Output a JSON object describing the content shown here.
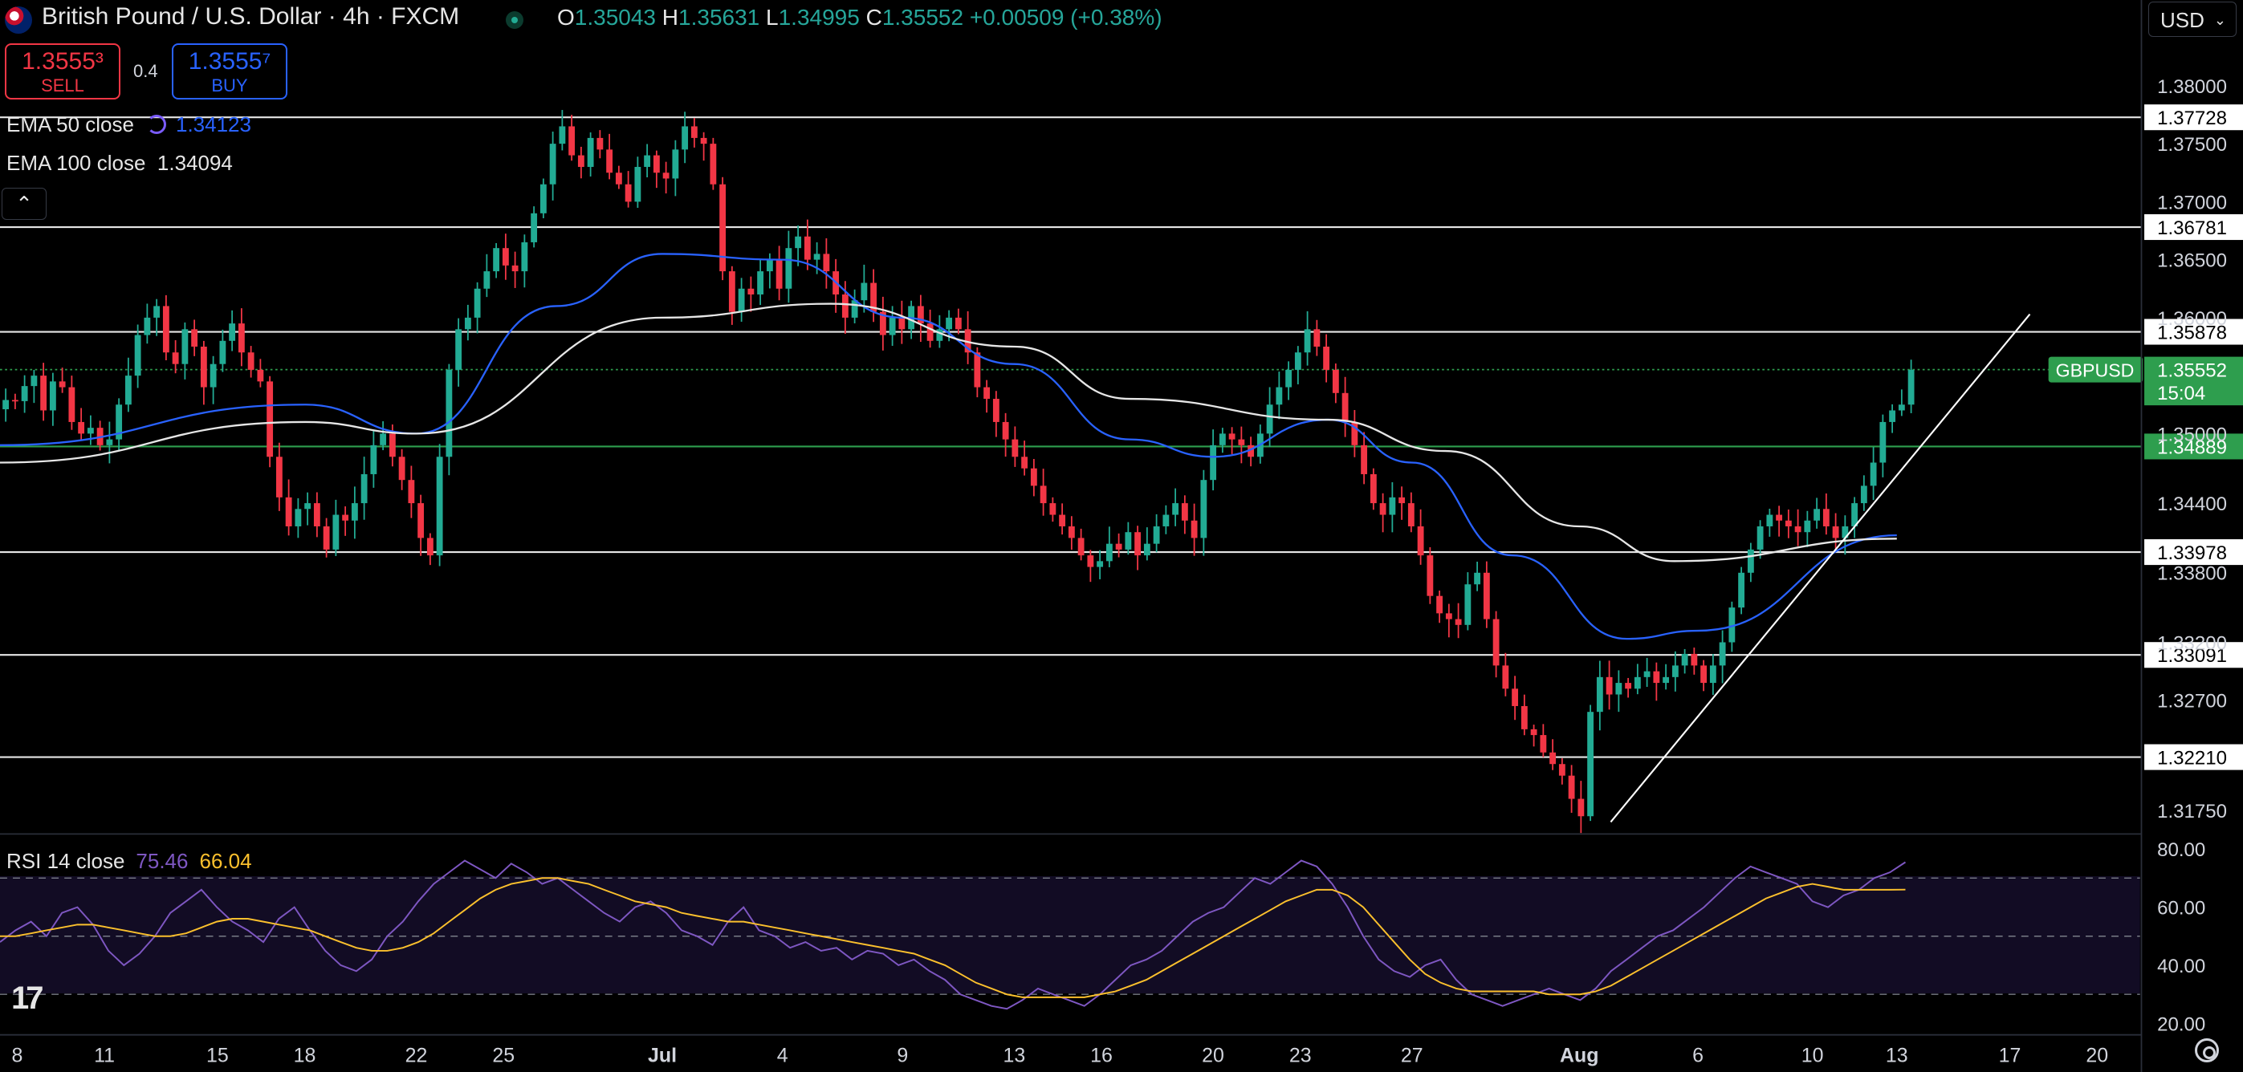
{
  "header": {
    "title": "British Pound / U.S. Dollar · 4h · FXCM",
    "ohlc": [
      {
        "k": "O",
        "v": "1.35043"
      },
      {
        "k": "H",
        "v": "1.35631"
      },
      {
        "k": "L",
        "v": "1.34995"
      },
      {
        "k": "C",
        "v": "1.35552"
      }
    ],
    "change": "+0.00509 (+0.38%)"
  },
  "trade": {
    "sell_price": "1.3555³",
    "sell_label": "SELL",
    "spread": "0.4",
    "buy_price": "1.3555⁷",
    "buy_label": "BUY"
  },
  "indicators": {
    "ema50_label": "EMA 50 close",
    "ema50_value": "1.34123",
    "ema100_label": "EMA 100 close",
    "ema100_value": "1.34094",
    "rsi_label": "RSI 14 close",
    "rsi_value": "75.46",
    "rsi_ma_value": "66.04"
  },
  "currency": "USD",
  "symbol_tag": {
    "symbol": "GBPUSD",
    "price": "1.35552",
    "countdown": "15:04"
  },
  "colors": {
    "up": "#26a69a",
    "up_candle": "#22ab94",
    "down": "#f23645",
    "ema50": "#2962ff",
    "ema100": "#e6e6e6",
    "rsi": "#7e57c2",
    "rsi_ma": "#fbc02d",
    "accent_green": "#2e9e4e"
  },
  "icons": [
    "flag-gb-icon",
    "market-status-icon",
    "sync-icon",
    "chevron-up-icon",
    "tradingview-logo",
    "settings-icon"
  ],
  "chart_data": {
    "type": "candlestick",
    "symbol": "GBPUSD",
    "timeframe": "4h",
    "price_axis_labels": [
      "1.38000",
      "1.37500",
      "1.37000",
      "1.36500",
      "1.36000",
      "1.35000",
      "1.34400",
      "1.33800",
      "1.33200",
      "1.32700",
      "1.31750"
    ],
    "ylim": [
      1.3165,
      1.3825
    ],
    "horizontal_levels": [
      {
        "value": 1.37728,
        "label": "1.37728"
      },
      {
        "value": 1.36781,
        "label": "1.36781"
      },
      {
        "value": 1.35878,
        "label": "1.35878"
      },
      {
        "value": 1.34889,
        "label": "1.34889",
        "color": "green"
      },
      {
        "value": 1.33978,
        "label": "1.33978"
      },
      {
        "value": 1.33091,
        "label": "1.33091"
      },
      {
        "value": 1.3221,
        "label": "1.32210"
      }
    ],
    "x_tick_labels": [
      "8",
      "11",
      "15",
      "18",
      "22",
      "25",
      "Jul",
      "4",
      "9",
      "13",
      "16",
      "20",
      "23",
      "27",
      "Aug",
      "6",
      "10",
      "13",
      "17",
      "20"
    ],
    "trendline": [
      {
        "date": "Aug 1",
        "price": 1.3165
      },
      {
        "date": "Aug 16",
        "price": 1.3603
      }
    ],
    "last_price": 1.35552,
    "candles_by_session_close": [
      1.3529,
      1.3528,
      1.3541,
      1.355,
      1.352,
      1.3545,
      1.354,
      1.351,
      1.35,
      1.3505,
      1.349,
      1.3495,
      1.3525,
      1.355,
      1.3585,
      1.36,
      1.361,
      1.357,
      1.356,
      1.359,
      1.3575,
      1.354,
      1.356,
      1.358,
      1.3595,
      1.357,
      1.3555,
      1.3545,
      1.348,
      1.3445,
      1.342,
      1.3435,
      1.344,
      1.342,
      1.34,
      1.343,
      1.3425,
      1.344,
      1.3465,
      1.349,
      1.35,
      1.348,
      1.346,
      1.344,
      1.341,
      1.3395,
      1.348,
      1.3555,
      1.359,
      1.36,
      1.3625,
      1.364,
      1.366,
      1.3645,
      1.364,
      1.3665,
      1.369,
      1.3715,
      1.375,
      1.3765,
      1.374,
      1.373,
      1.3755,
      1.3745,
      1.3725,
      1.3715,
      1.37,
      1.373,
      1.374,
      1.3725,
      1.372,
      1.3745,
      1.3765,
      1.3755,
      1.375,
      1.3715,
      1.364,
      1.3605,
      1.3625,
      1.362,
      1.364,
      1.365,
      1.3625,
      1.366,
      1.367,
      1.365,
      1.3655,
      1.364,
      1.362,
      1.36,
      1.3615,
      1.363,
      1.3605,
      1.3585,
      1.36,
      1.359,
      1.361,
      1.3595,
      1.358,
      1.359,
      1.36,
      1.359,
      1.357,
      1.354,
      1.353,
      1.351,
      1.3495,
      1.348,
      1.347,
      1.3455,
      1.344,
      1.343,
      1.342,
      1.341,
      1.3395,
      1.3385,
      1.339,
      1.3405,
      1.34,
      1.3415,
      1.3395,
      1.3405,
      1.342,
      1.343,
      1.344,
      1.3425,
      1.341,
      1.346,
      1.349,
      1.35,
      1.3495,
      1.349,
      1.348,
      1.35,
      1.3525,
      1.354,
      1.3555,
      1.357,
      1.359,
      1.3575,
      1.3555,
      1.3535,
      1.351,
      1.349,
      1.3465,
      1.344,
      1.343,
      1.3445,
      1.344,
      1.342,
      1.3395,
      1.336,
      1.3345,
      1.334,
      1.3335,
      1.337,
      1.338,
      1.334,
      1.33,
      1.328,
      1.3265,
      1.3245,
      1.324,
      1.3225,
      1.3215,
      1.3205,
      1.3185,
      1.317,
      1.326,
      1.329,
      1.3275,
      1.3285,
      1.328,
      1.329,
      1.3295,
      1.3285,
      1.329,
      1.33,
      1.331,
      1.33,
      1.3285,
      1.33,
      1.332,
      1.335,
      1.338,
      1.34,
      1.342,
      1.343,
      1.3425,
      1.342,
      1.3415,
      1.3425,
      1.3435,
      1.342,
      1.341,
      1.342,
      1.344,
      1.3455,
      1.3475,
      1.351,
      1.352,
      1.3525,
      1.3555
    ],
    "ema50": [
      {
        "date": "Jun 8",
        "value": 1.349
      },
      {
        "date": "Jun 18",
        "value": 1.3525
      },
      {
        "date": "Jun 22",
        "value": 1.35
      },
      {
        "date": "Jun 27",
        "value": 1.361
      },
      {
        "date": "Jul 1",
        "value": 1.3655
      },
      {
        "date": "Jul 4",
        "value": 1.365
      },
      {
        "date": "Jul 9",
        "value": 1.36
      },
      {
        "date": "Jul 13",
        "value": 1.356
      },
      {
        "date": "Jul 17",
        "value": 1.3495
      },
      {
        "date": "Jul 20",
        "value": 1.348
      },
      {
        "date": "Jul 24",
        "value": 1.3512
      },
      {
        "date": "Jul 27",
        "value": 1.3475
      },
      {
        "date": "Jul 30",
        "value": 1.3395
      },
      {
        "date": "Aug 3",
        "value": 1.3323
      },
      {
        "date": "Aug 6",
        "value": 1.333
      },
      {
        "date": "Aug 13",
        "value": 1.34123
      }
    ],
    "ema100": [
      {
        "date": "Jun 8",
        "value": 1.3475
      },
      {
        "date": "Jun 18",
        "value": 1.351
      },
      {
        "date": "Jun 22",
        "value": 1.35
      },
      {
        "date": "Jul 1",
        "value": 1.36
      },
      {
        "date": "Jul 6",
        "value": 1.3612
      },
      {
        "date": "Jul 13",
        "value": 1.3575
      },
      {
        "date": "Jul 17",
        "value": 1.353
      },
      {
        "date": "Jul 24",
        "value": 1.3512
      },
      {
        "date": "Jul 28",
        "value": 1.3485
      },
      {
        "date": "Aug 1",
        "value": 1.342
      },
      {
        "date": "Aug 5",
        "value": 1.339
      },
      {
        "date": "Aug 13",
        "value": 1.34094
      }
    ],
    "rsi": {
      "ylim": [
        20,
        80
      ],
      "axis_labels": [
        "80.00",
        "60.00",
        "40.00",
        "20.00"
      ],
      "bands": [
        70,
        50,
        30
      ],
      "rsi_values": [
        48,
        52,
        55,
        50,
        58,
        60,
        54,
        45,
        40,
        44,
        50,
        58,
        62,
        66,
        60,
        55,
        52,
        48,
        56,
        60,
        52,
        45,
        40,
        38,
        42,
        50,
        55,
        62,
        68,
        72,
        76,
        73,
        70,
        75,
        72,
        68,
        70,
        66,
        62,
        58,
        55,
        60,
        62,
        58,
        52,
        50,
        47,
        55,
        60,
        52,
        50,
        46,
        48,
        45,
        46,
        42,
        45,
        44,
        40,
        42,
        38,
        35,
        30,
        28,
        26,
        25,
        28,
        32,
        30,
        28,
        26,
        30,
        35,
        40,
        42,
        45,
        50,
        55,
        58,
        60,
        65,
        70,
        68,
        72,
        76,
        74,
        68,
        60,
        50,
        42,
        38,
        36,
        40,
        42,
        35,
        30,
        28,
        26,
        28,
        30,
        32,
        30,
        28,
        32,
        38,
        42,
        46,
        50,
        52,
        56,
        60,
        65,
        70,
        74,
        72,
        70,
        68,
        62,
        60,
        64,
        66,
        70,
        72,
        75.46
      ],
      "ma_values": [
        50,
        50,
        51,
        52,
        53,
        54,
        54,
        53,
        52,
        51,
        50,
        50,
        51,
        53,
        55,
        56,
        56,
        55,
        54,
        53,
        52,
        50,
        48,
        46,
        45,
        45,
        46,
        48,
        51,
        55,
        59,
        63,
        66,
        68,
        69,
        70,
        70,
        69,
        68,
        66,
        64,
        62,
        61,
        60,
        58,
        57,
        56,
        55,
        55,
        54,
        53,
        52,
        51,
        50,
        49,
        48,
        47,
        46,
        45,
        44,
        42,
        40,
        37,
        34,
        32,
        30,
        29,
        29,
        29,
        29,
        29,
        30,
        31,
        33,
        35,
        38,
        41,
        44,
        47,
        50,
        53,
        56,
        59,
        62,
        64,
        66,
        66,
        64,
        60,
        54,
        48,
        42,
        37,
        34,
        32,
        31,
        31,
        31,
        31,
        31,
        30,
        30,
        30,
        31,
        33,
        36,
        39,
        42,
        45,
        48,
        51,
        54,
        57,
        60,
        63,
        65,
        67,
        68,
        67,
        66,
        66,
        66,
        66,
        66.04
      ]
    }
  }
}
